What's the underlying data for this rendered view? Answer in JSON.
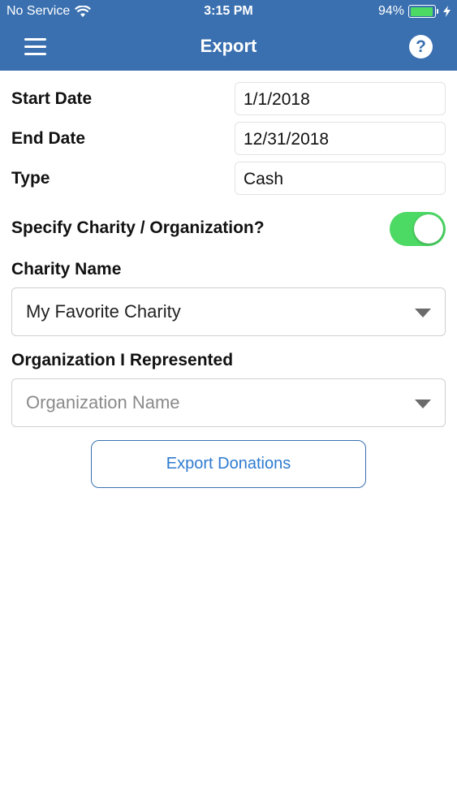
{
  "status_bar": {
    "carrier": "No Service",
    "time": "3:15 PM",
    "battery": "94%",
    "battery_level": 0.94
  },
  "nav": {
    "title": "Export",
    "menu_icon": "hamburger-menu-icon",
    "help_icon": "question-circle-icon",
    "help_glyph": "?"
  },
  "form": {
    "rows": [
      {
        "label": "Start Date",
        "value": "1/1/2018"
      },
      {
        "label": "End Date",
        "value": "12/31/2018"
      },
      {
        "label": "Type",
        "value": "Cash"
      }
    ],
    "toggle": {
      "label": "Specify Charity / Organization?",
      "on": true,
      "color": "#4cd964"
    },
    "charity": {
      "label": "Charity Name",
      "value": "My Favorite Charity"
    },
    "organization": {
      "label": "Organization I Represented",
      "placeholder": "Organization Name"
    },
    "export_button": "Export Donations"
  },
  "colors": {
    "header": "#3a70b0",
    "accent": "#2e7bd0",
    "toggle_on": "#4cd964"
  }
}
